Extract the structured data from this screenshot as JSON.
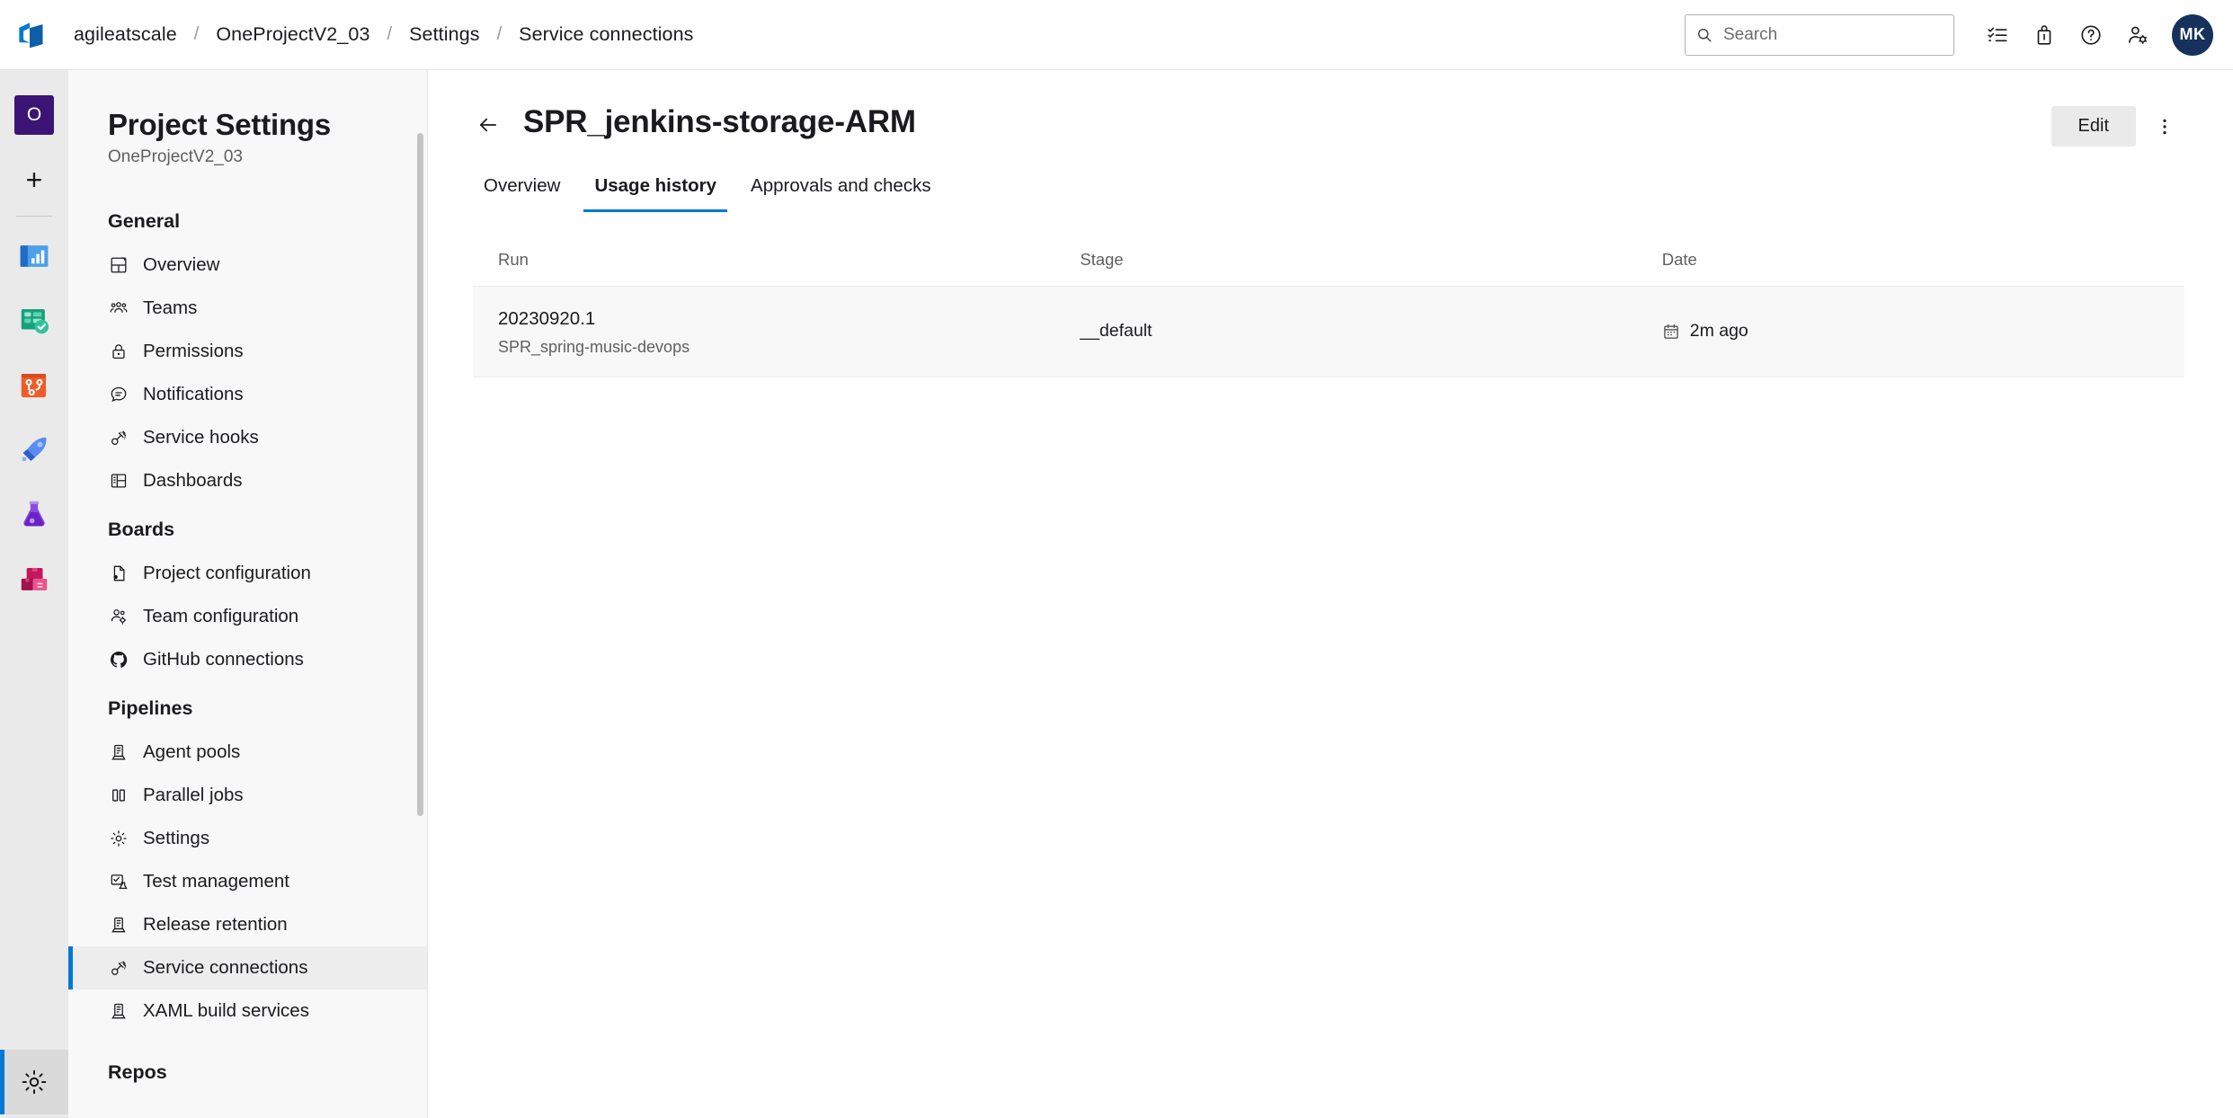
{
  "topbar": {
    "logo_icon": "azure-devops-logo",
    "breadcrumb": [
      {
        "label": "agileatscale"
      },
      {
        "label": "OneProjectV2_03"
      },
      {
        "label": "Settings"
      },
      {
        "label": "Service connections"
      }
    ],
    "separator": "/",
    "search": {
      "placeholder": "Search",
      "value": "",
      "icon": "search-icon"
    },
    "actions": [
      {
        "name": "work-items-icon",
        "label": "Work items"
      },
      {
        "name": "marketplace-icon",
        "label": "Marketplace"
      },
      {
        "name": "help-icon",
        "label": "Help"
      },
      {
        "name": "user-settings-icon",
        "label": "User settings"
      }
    ],
    "avatar_initials": "MK"
  },
  "rail": {
    "project_initial": "O",
    "add_label": "+",
    "items": [
      {
        "name": "overview-hub-icon",
        "label": "Overview"
      },
      {
        "name": "boards-hub-icon",
        "label": "Boards"
      },
      {
        "name": "repos-hub-icon",
        "label": "Repos"
      },
      {
        "name": "pipelines-hub-icon",
        "label": "Pipelines"
      },
      {
        "name": "test-plans-hub-icon",
        "label": "Test Plans"
      },
      {
        "name": "artifacts-hub-icon",
        "label": "Artifacts"
      }
    ],
    "bottom": {
      "name": "project-settings-gear-icon",
      "label": "Project settings",
      "active": true
    }
  },
  "sidebar": {
    "title": "Project Settings",
    "subtitle": "OneProjectV2_03",
    "groups": [
      {
        "label": "General",
        "items": [
          {
            "label": "Overview",
            "icon": "overview-icon"
          },
          {
            "label": "Teams",
            "icon": "teams-icon"
          },
          {
            "label": "Permissions",
            "icon": "lock-icon"
          },
          {
            "label": "Notifications",
            "icon": "comment-icon"
          },
          {
            "label": "Service hooks",
            "icon": "plug-icon"
          },
          {
            "label": "Dashboards",
            "icon": "dashboard-icon"
          }
        ]
      },
      {
        "label": "Boards",
        "items": [
          {
            "label": "Project configuration",
            "icon": "page-settings-icon"
          },
          {
            "label": "Team configuration",
            "icon": "team-settings-icon"
          },
          {
            "label": "GitHub connections",
            "icon": "github-icon"
          }
        ]
      },
      {
        "label": "Pipelines",
        "items": [
          {
            "label": "Agent pools",
            "icon": "agent-icon"
          },
          {
            "label": "Parallel jobs",
            "icon": "parallel-icon"
          },
          {
            "label": "Settings",
            "icon": "gear-icon"
          },
          {
            "label": "Test management",
            "icon": "test-icon"
          },
          {
            "label": "Release retention",
            "icon": "agent-icon"
          },
          {
            "label": "Service connections",
            "icon": "plug-icon",
            "selected": true
          },
          {
            "label": "XAML build services",
            "icon": "agent-icon"
          }
        ]
      },
      {
        "label": "Repos",
        "items": []
      }
    ]
  },
  "main": {
    "back_icon": "back-arrow-icon",
    "title": "SPR_jenkins-storage-ARM",
    "edit_label": "Edit",
    "more_icon": "more-vertical-icon",
    "tabs": [
      {
        "label": "Overview",
        "active": false
      },
      {
        "label": "Usage history",
        "active": true
      },
      {
        "label": "Approvals and checks",
        "active": false
      }
    ],
    "table": {
      "columns": [
        {
          "key": "run",
          "label": "Run"
        },
        {
          "key": "stage",
          "label": "Stage"
        },
        {
          "key": "date",
          "label": "Date"
        }
      ],
      "rows": [
        {
          "run": "20230920.1",
          "run_sub": "SPR_spring-music-devops",
          "stage": "__default",
          "date": "2m ago",
          "date_icon": "calendar-icon"
        }
      ]
    }
  },
  "colors": {
    "accent": "#0078d4",
    "avatar_bg": "#16325c",
    "project_avatar_bg": "#3b1475",
    "sidebar_bg": "#f8f8f8",
    "rail_bg": "#eaeaea",
    "row_bg": "#f8f8f8"
  }
}
